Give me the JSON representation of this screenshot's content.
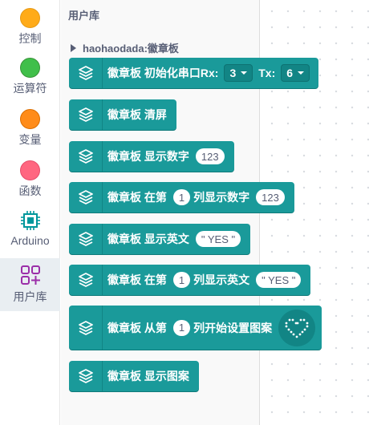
{
  "categories": [
    {
      "label": "控制",
      "color": "#ffab19"
    },
    {
      "label": "运算符",
      "color": "#40bf4a"
    },
    {
      "label": "变量",
      "color": "#ff8c1a"
    },
    {
      "label": "函数",
      "color": "#ff6680"
    },
    {
      "label": "Arduino",
      "color": "#00979c"
    },
    {
      "label": "用户库",
      "color": "#9b2ea8"
    }
  ],
  "flyout": {
    "title": "用户库",
    "group": "haohaodada:徽章板"
  },
  "blocks": {
    "init_serial": {
      "prefix": "徽章板 初始化串口Rx:",
      "rx_value": "3",
      "tx_label": "Tx:",
      "tx_value": "6"
    },
    "clear": {
      "label": "徽章板 清屏"
    },
    "show_number": {
      "label": "徽章板 显示数字",
      "value": "123"
    },
    "show_number_at": {
      "label": "徽章板 在第",
      "col": "1",
      "suffix": "列显示数字",
      "value": "123"
    },
    "show_english": {
      "label": "徽章板 显示英文",
      "value": "\" YES \""
    },
    "show_english_at": {
      "label": "徽章板 在第",
      "col": "1",
      "suffix": "列显示英文",
      "value": "\" YES \""
    },
    "set_pattern": {
      "label": "徽章板 从第",
      "col": "1",
      "suffix": "列开始设置图案",
      "pattern": "heart-icon"
    },
    "show_pattern": {
      "label": "徽章板 显示图案"
    }
  }
}
